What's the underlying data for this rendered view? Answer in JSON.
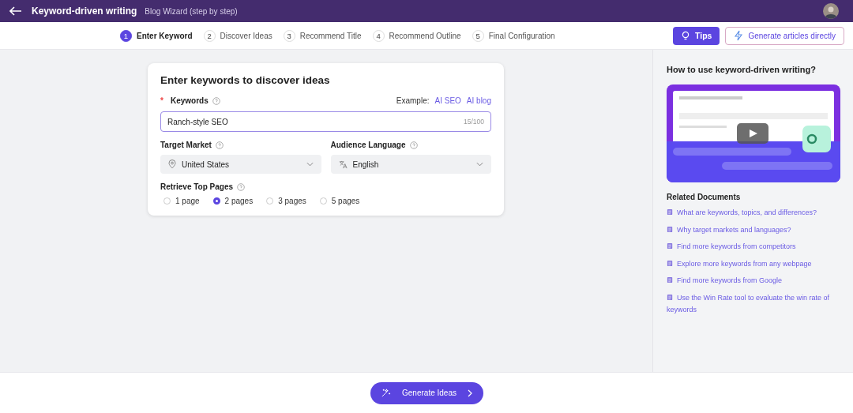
{
  "header": {
    "title": "Keyword-driven writing",
    "subtitle": "Blog Wizard (step by step)"
  },
  "steps": [
    {
      "number": "1",
      "label": "Enter Keyword",
      "selected": true
    },
    {
      "number": "2",
      "label": "Discover Ideas",
      "selected": false
    },
    {
      "number": "3",
      "label": "Recommend Title",
      "selected": false
    },
    {
      "number": "4",
      "label": "Recommend Outline",
      "selected": false
    },
    {
      "number": "5",
      "label": "Final Configuration",
      "selected": false
    }
  ],
  "actions": {
    "tips": "Tips",
    "generate_direct": "Generate articles directly"
  },
  "form": {
    "title": "Enter keywords to discover ideas",
    "required_mark": "*",
    "keywords_label": "Keywords",
    "example_label": "Example:",
    "examples": [
      "AI SEO",
      "AI blog"
    ],
    "keyword_value": "Ranch-style SEO",
    "keyword_count": "15/100",
    "market_label": "Target Market",
    "market_value": "United States",
    "language_label": "Audience Language",
    "language_value": "English",
    "pages_label": "Retrieve Top Pages",
    "pages": [
      {
        "label": "1 page",
        "selected": false
      },
      {
        "label": "2 pages",
        "selected": true
      },
      {
        "label": "3 pages",
        "selected": false
      },
      {
        "label": "5 pages",
        "selected": false
      }
    ]
  },
  "sidebar": {
    "title": "How to use keyword-driven writing?",
    "related_title": "Related Documents",
    "documents": [
      "What are keywords, topics, and differences?",
      "Why target markets and languages?",
      "Find more keywords from competitors",
      "Explore more keywords from any webpage",
      "Find more keywords from Google",
      "Use the Win Rate tool to evaluate the win rate of keywords"
    ]
  },
  "footer": {
    "button": "Generate Ideas"
  }
}
